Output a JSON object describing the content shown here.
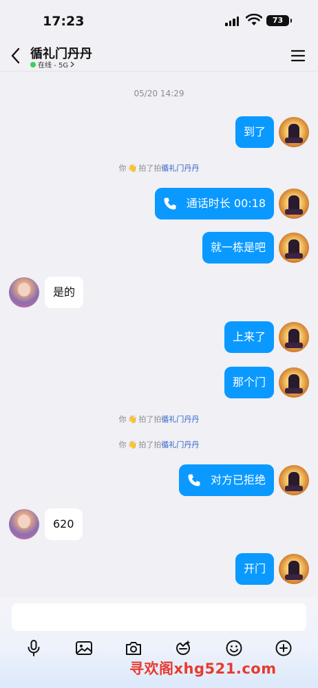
{
  "status_bar": {
    "time": "17:23",
    "battery": "73"
  },
  "header": {
    "title": "循礼门丹丹",
    "presence": "在线 - 5G"
  },
  "chat": {
    "timestamp": "05/20 14:29",
    "messages": [
      {
        "text": "到了"
      },
      {
        "text": "通话时长 00:18"
      },
      {
        "text": "就一栋是吧"
      },
      {
        "text": "是的"
      },
      {
        "text": "上来了"
      },
      {
        "text": "那个门"
      },
      {
        "text": "对方已拒绝"
      },
      {
        "text": "620"
      },
      {
        "text": "开门"
      }
    ],
    "pokes": [
      {
        "you": "你",
        "action": "拍了拍",
        "name": "循礼门丹丹"
      },
      {
        "you": "你",
        "action": "拍了拍",
        "name": "循礼门丹丹"
      },
      {
        "you": "你",
        "action": "拍了拍",
        "name": "循礼门丹丹"
      }
    ]
  },
  "input": {
    "placeholder": ""
  },
  "watermark": "寻欢阁xhg521.com",
  "colors": {
    "self_bubble": "#0a99ff",
    "other_bubble": "#ffffff",
    "online": "#37d158",
    "poke_name": "#2c63c8"
  },
  "toolbar": [
    "microphone-icon",
    "image-icon",
    "camera-icon",
    "sticker-icon",
    "emoji-icon",
    "plus-icon"
  ]
}
